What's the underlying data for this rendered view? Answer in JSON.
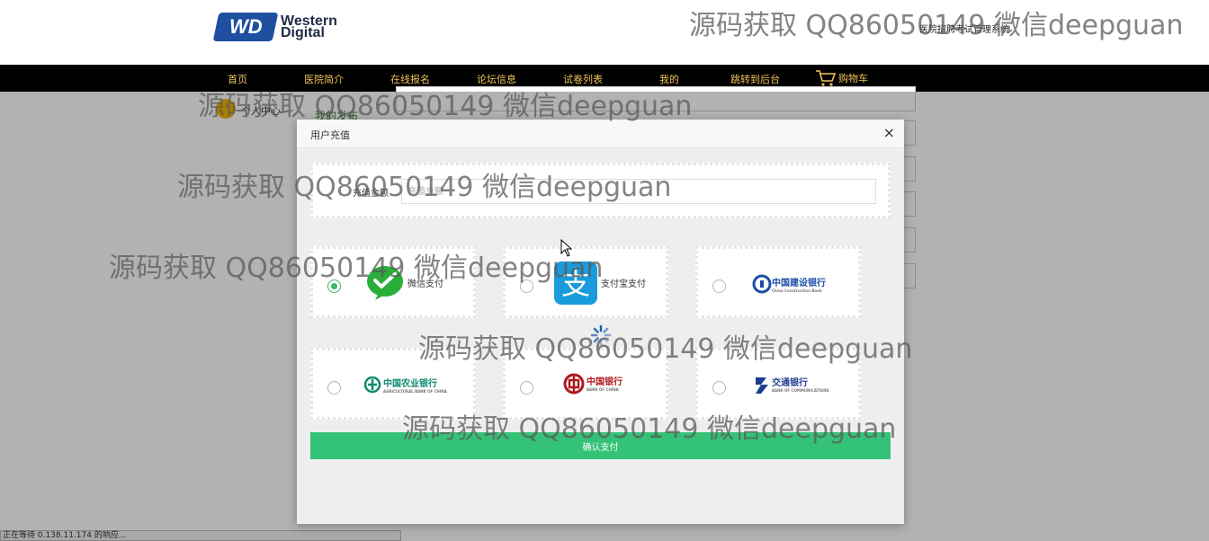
{
  "header": {
    "logo_text_line1": "Western",
    "logo_text_line2": "Digital",
    "logo_badge": "WD",
    "site_title": "医院招聘考试管理系统"
  },
  "nav": {
    "items": [
      "首页",
      "医院简介",
      "在线报名",
      "论坛信息",
      "试卷列表",
      "我的",
      "跳转到后台"
    ],
    "cart_label": "购物车"
  },
  "background": {
    "sidebar_label": "个人中心",
    "publish_label": "我的发布",
    "status_text": "正在等待 0.138.11.174 的响应..."
  },
  "modal": {
    "title": "用户充值",
    "close": "×",
    "amount_label": "充值金额",
    "amount_placeholder": "充值金额",
    "confirm_label": "确认支付",
    "payment_methods": [
      {
        "name": "微信支付",
        "icon": "wechat-pay-icon",
        "checked": true
      },
      {
        "name": "支付宝支付",
        "icon": "alipay-icon",
        "checked": false
      },
      {
        "name": "中国建设银行",
        "sub": "China Construction Bank",
        "icon": "ccb-icon",
        "checked": false
      },
      {
        "name": "中国农业银行",
        "sub": "AGRICULTURAL BANK OF CHINA",
        "icon": "abc-icon",
        "checked": false
      },
      {
        "name": "中国银行",
        "sub": "BANK OF CHINA",
        "icon": "boc-icon",
        "checked": false
      },
      {
        "name": "交通银行",
        "sub": "BANK OF COMMUNICATIONS",
        "icon": "bocom-icon",
        "checked": false
      }
    ]
  },
  "watermark": "源码获取 QQ86050149 微信deepguan",
  "colors": {
    "nav_bg": "#000000",
    "nav_text": "#f0c35a",
    "confirm_button": "#34c276",
    "radio_checked": "#3ab56a",
    "wechat_green": "#2aae3a",
    "alipay_blue": "#1a9bdb"
  }
}
